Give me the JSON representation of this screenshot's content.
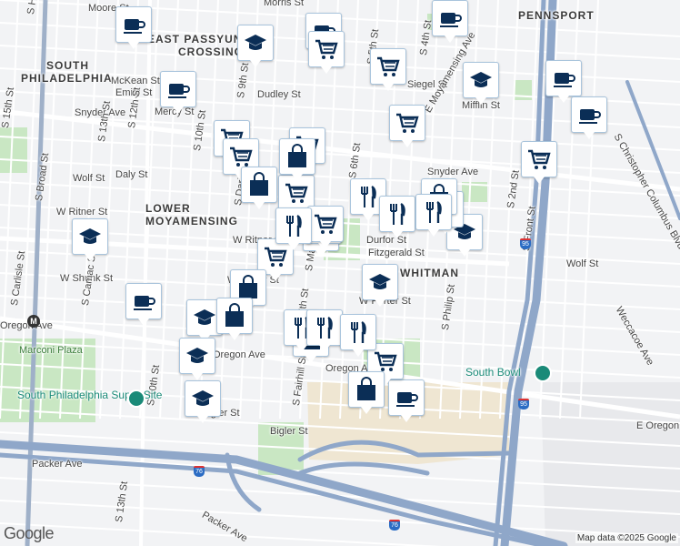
{
  "neighborhoods": [
    {
      "text": "EAST PASSYUNK",
      "style": "nb"
    },
    {
      "text": "CROSSING",
      "style": "nb"
    },
    {
      "text": "SOUTH",
      "style": "nb"
    },
    {
      "text": "PHILADELPHIA",
      "style": "nb"
    },
    {
      "text": "LOWER",
      "style": "nb"
    },
    {
      "text": "MOYAMENSING",
      "style": "nb"
    },
    {
      "text": "WHITMAN",
      "style": "nb"
    },
    {
      "text": "PENNSPORT",
      "style": "nb"
    }
  ],
  "street_labels": [
    "Morris St",
    "Moore St",
    "McKean St",
    "Emily St",
    "Mercy St",
    "Dudley St",
    "Siegel St",
    "Mifflin St",
    "Snyder Ave",
    "Wolf St",
    "Daly St",
    "W Ritner St",
    "W Ritner St",
    "W Porter St",
    "W Shunk St",
    "Oregon Ave",
    "Oregon Ave",
    "Oregon Ave",
    "Durfor St",
    "Fitzgerald St",
    "Wolf St",
    "W Porter St",
    "Snyder Ave",
    "Bigler St",
    "Bigler St",
    "Packer Ave",
    "Packer Ave",
    "E Oregon Ave",
    "S Broad St",
    "S 15th St",
    "S 13th St",
    "S 12th St",
    "S 10th St",
    "S 9th St",
    "S 6th St",
    "S 5th St",
    "S 4th St",
    "E Moyamensing Ave",
    "S Front St",
    "S Christopher Columbus Blvd",
    "Weccacoe Ave",
    "S Philip St",
    "S 2nd St",
    "S Fairhill St",
    "S Marshall St",
    "S Carlisle St",
    "S Camac St",
    "S 10th St",
    "S 13th St",
    "S Hicks St",
    "S 7th St",
    "W Shunk St",
    "S Darien St"
  ],
  "places": [
    {
      "text": "Marconi Plaza",
      "type": "park"
    },
    {
      "text": "South Philadelphia Super Site",
      "type": "poi"
    },
    {
      "text": "South Bowl",
      "type": "poi"
    }
  ],
  "metro": {
    "text": "M"
  },
  "highways": [
    "95",
    "95",
    "76",
    "76"
  ],
  "markers": [
    {
      "icon": "coffee-icon"
    },
    {
      "icon": "coffee-icon"
    },
    {
      "icon": "coffee-icon"
    },
    {
      "icon": "coffee-icon"
    },
    {
      "icon": "coffee-icon"
    },
    {
      "icon": "coffee-icon"
    },
    {
      "icon": "coffee-icon"
    },
    {
      "icon": "coffee-icon"
    },
    {
      "icon": "school-icon"
    },
    {
      "icon": "school-icon"
    },
    {
      "icon": "school-icon"
    },
    {
      "icon": "school-icon"
    },
    {
      "icon": "school-icon"
    },
    {
      "icon": "school-icon"
    },
    {
      "icon": "school-icon"
    },
    {
      "icon": "school-icon"
    },
    {
      "icon": "school-icon"
    },
    {
      "icon": "school-icon"
    },
    {
      "icon": "school-icon"
    },
    {
      "icon": "cart-icon"
    },
    {
      "icon": "cart-icon"
    },
    {
      "icon": "cart-icon"
    },
    {
      "icon": "cart-icon"
    },
    {
      "icon": "cart-icon"
    },
    {
      "icon": "cart-icon"
    },
    {
      "icon": "cart-icon"
    },
    {
      "icon": "cart-icon"
    },
    {
      "icon": "cart-icon"
    },
    {
      "icon": "cart-icon"
    },
    {
      "icon": "cart-icon"
    },
    {
      "icon": "bag-icon"
    },
    {
      "icon": "bag-icon"
    },
    {
      "icon": "bag-icon"
    },
    {
      "icon": "bag-icon"
    },
    {
      "icon": "bag-icon"
    },
    {
      "icon": "bag-icon"
    },
    {
      "icon": "bag-icon"
    },
    {
      "icon": "restaurant-icon"
    },
    {
      "icon": "restaurant-icon"
    },
    {
      "icon": "restaurant-icon"
    },
    {
      "icon": "restaurant-icon"
    },
    {
      "icon": "restaurant-icon"
    },
    {
      "icon": "restaurant-icon"
    },
    {
      "icon": "restaurant-icon"
    }
  ],
  "branding": {
    "logo": "Google",
    "attribution": "Map data ©2025 Google"
  },
  "colors": {
    "marker_fill": "#0b2e56",
    "park": "#c9e7c3",
    "highway": "#8fa7c9",
    "poi": "#1a8a78",
    "industrial": "#efe6d2"
  }
}
